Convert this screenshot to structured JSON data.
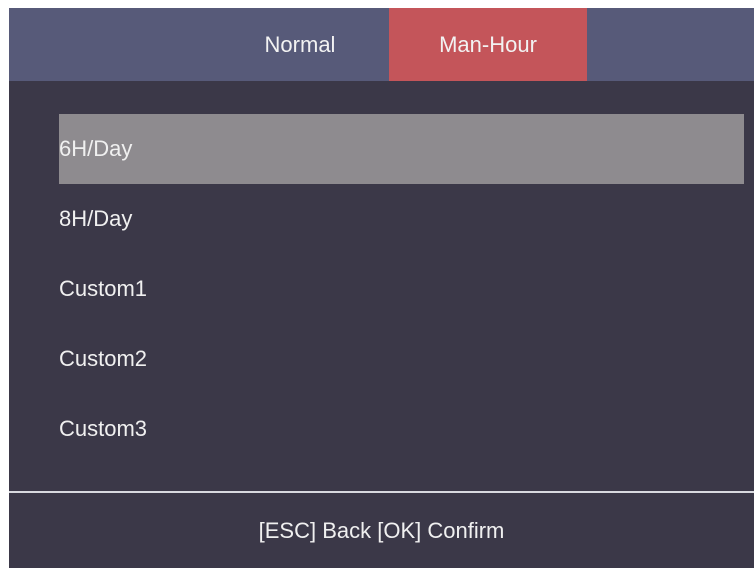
{
  "tabs": [
    {
      "label": "Normal",
      "active": false
    },
    {
      "label": "Man-Hour",
      "active": true
    }
  ],
  "list": {
    "selected_index": 0,
    "items": [
      {
        "label": "6H/Day"
      },
      {
        "label": "8H/Day"
      },
      {
        "label": "Custom1"
      },
      {
        "label": "Custom2"
      },
      {
        "label": "Custom3"
      }
    ]
  },
  "footer": {
    "hint": "[ESC] Back [OK] Confirm"
  },
  "colors": {
    "background": "#3b3848",
    "tab_bar": "#575a79",
    "active_tab": "#c4555a",
    "selected_row": "#8e8b8f",
    "text": "#f0f0f0"
  }
}
